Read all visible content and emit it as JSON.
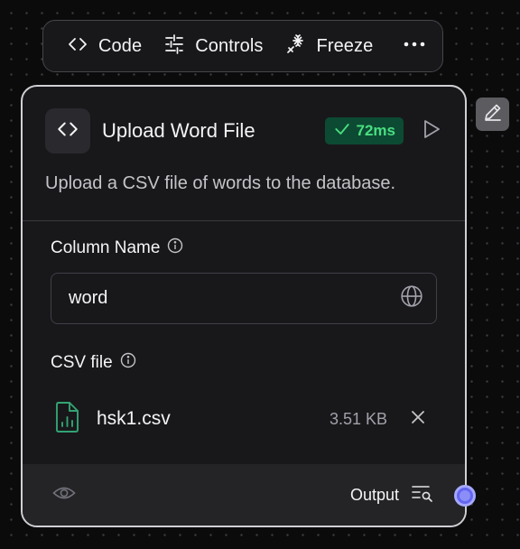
{
  "toolbar": {
    "code_label": "Code",
    "controls_label": "Controls",
    "freeze_label": "Freeze"
  },
  "node": {
    "title": "Upload Word File",
    "run_time": "72ms",
    "description": "Upload a CSV file of words to the database.",
    "column_name": {
      "label": "Column Name",
      "value": "word"
    },
    "csv_file": {
      "label": "CSV file",
      "file_name": "hsk1.csv",
      "file_size": "3.51 KB"
    },
    "footer": {
      "output_label": "Output"
    }
  },
  "colors": {
    "accent": "#6366f1",
    "success_bg": "#0d4a33",
    "success_text": "#4ade80",
    "file_icon": "#34a373"
  },
  "icons": [
    "code-icon",
    "sliders-icon",
    "snowflake-icon",
    "more-icon",
    "check-icon",
    "play-icon",
    "info-icon",
    "globe-icon",
    "file-chart-icon",
    "close-icon",
    "eye-icon",
    "output-list-icon",
    "pencil-icon"
  ]
}
